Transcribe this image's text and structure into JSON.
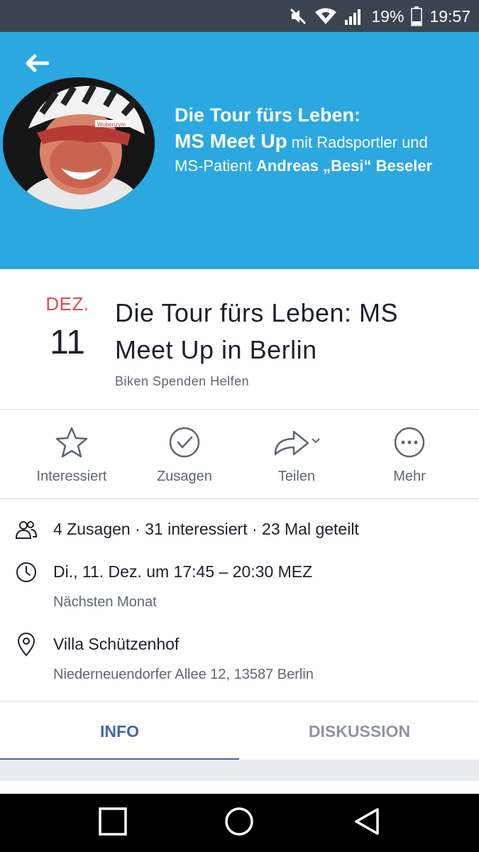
{
  "status_bar": {
    "battery_percent": "19%",
    "time": "19:57",
    "icons": [
      "mute-icon",
      "wifi-icon",
      "signal-icon",
      "battery-icon"
    ]
  },
  "cover": {
    "line1": "Die Tour fürs Leben:",
    "line2_bold": "MS Meet Up",
    "line2_rest": " mit Radsportler und",
    "line3_prefix": "MS-Patient ",
    "line3_bold": "Andreas „Besi“ Beseler",
    "background_color": "#2ba8e0"
  },
  "event": {
    "month": "DEZ.",
    "day": "11",
    "title": "Die Tour fürs Leben: MS Meet Up in Berlin",
    "host": "Biken Spenden Helfen"
  },
  "actions": [
    {
      "label": "Interessiert",
      "icon": "star-icon"
    },
    {
      "label": "Zusagen",
      "icon": "check-circle-icon"
    },
    {
      "label": "Teilen",
      "icon": "share-icon"
    },
    {
      "label": "Mehr",
      "icon": "more-icon"
    }
  ],
  "details": {
    "attendance": "4 Zusagen · 31 interessiert · 23 Mal geteilt",
    "datetime": "Di., 11. Dez. um 17:45 – 20:30 MEZ",
    "datetime_sub": "Nächsten Monat",
    "location": "Villa Schützenhof",
    "address": "Niederneuendorfer Allee 12, 13587 Berlin"
  },
  "tabs": {
    "info": "INFO",
    "discussion": "DISKUSSION",
    "active": "INFO"
  },
  "colors": {
    "accent": "#4267b2",
    "date_red": "#e04b4b"
  }
}
